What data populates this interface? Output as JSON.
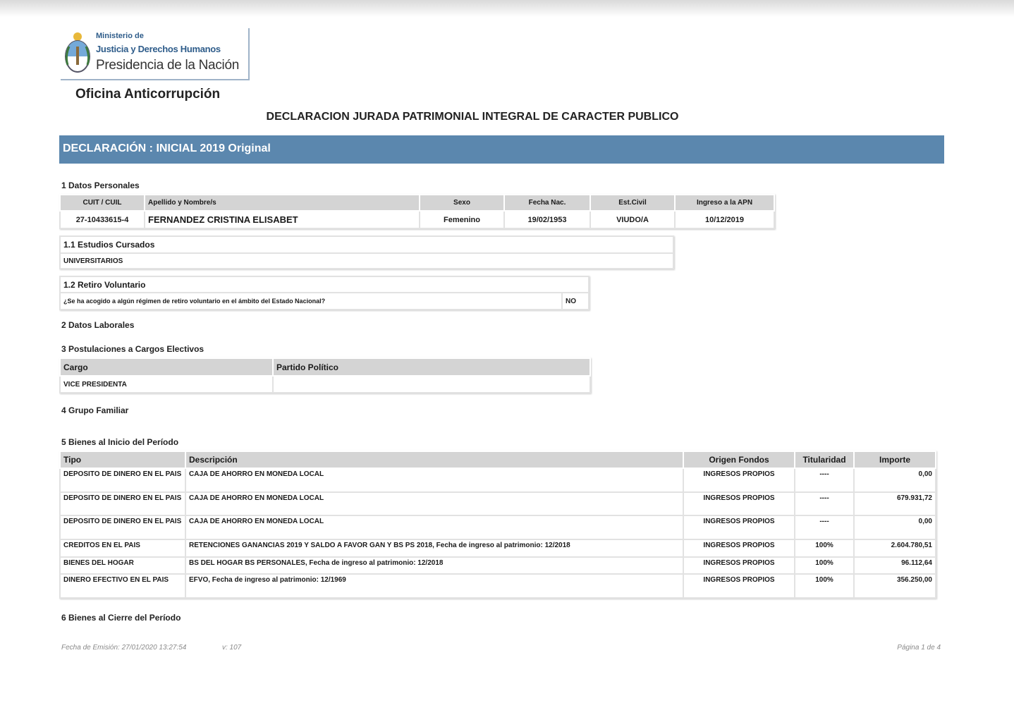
{
  "header": {
    "logo_line1": "Ministerio de",
    "logo_line2": "Justicia y Derechos Humanos",
    "logo_line3": "Presidencia de la Nación",
    "office": "Oficina Anticorrupción",
    "doc_title": "DECLARACION JURADA PATRIMONIAL INTEGRAL DE CARACTER PUBLICO"
  },
  "banner": "DECLARACIÓN :  INICIAL 2019 Original",
  "personal": {
    "section_title": "1 Datos Personales",
    "headers": [
      "CUIT / CUIL",
      "Apellido y Nombre/s",
      "Sexo",
      "Fecha Nac.",
      "Est.Civil",
      "Ingreso a la APN"
    ],
    "values": [
      "27-10433615-4",
      "FERNANDEZ CRISTINA ELISABET",
      "Femenino",
      "19/02/1953",
      "VIUDO/A",
      "10/12/2019"
    ]
  },
  "estudios": {
    "title": "1.1 Estudios Cursados",
    "value": "UNIVERSITARIOS"
  },
  "retiro": {
    "title": "1.2 Retiro Voluntario",
    "question": "¿Se ha acogido a algún régimen de retiro voluntario en el ámbito del Estado Nacional?",
    "answer": "NO"
  },
  "laborales": {
    "title": "2 Datos Laborales"
  },
  "postulaciones": {
    "title": "3 Postulaciones a Cargos Electivos",
    "headers": [
      "Cargo",
      "Partido Político"
    ],
    "row": [
      "VICE PRESIDENTA",
      ""
    ]
  },
  "grupo": {
    "title": "4 Grupo Familiar"
  },
  "bienes_inicio": {
    "title": "5 Bienes al Inicio del Período",
    "headers": [
      "Tipo",
      "Descripción",
      "Origen Fondos",
      "Titularidad",
      "Importe"
    ],
    "rows": [
      [
        "DEPOSITO DE DINERO EN EL PAIS",
        "CAJA DE AHORRO EN MONEDA LOCAL",
        "INGRESOS PROPIOS",
        "----",
        "0,00"
      ],
      [
        "DEPOSITO DE DINERO EN EL PAIS",
        "CAJA DE AHORRO EN MONEDA LOCAL",
        "INGRESOS PROPIOS",
        "----",
        "679.931,72"
      ],
      [
        "DEPOSITO DE DINERO EN EL PAIS",
        "CAJA DE AHORRO EN MONEDA LOCAL",
        "INGRESOS PROPIOS",
        "----",
        "0,00"
      ],
      [
        "CREDITOS EN EL PAIS",
        "RETENCIONES GANANCIAS 2019 Y SALDO A FAVOR GAN Y BS PS 2018, Fecha de ingreso al patrimonio: 12/2018",
        "INGRESOS PROPIOS",
        "100%",
        "2.604.780,51"
      ],
      [
        "BIENES DEL HOGAR",
        "BS DEL HOGAR BS PERSONALES, Fecha de ingreso al patrimonio: 12/2018",
        "INGRESOS PROPIOS",
        "100%",
        "96.112,64"
      ],
      [
        "DINERO EFECTIVO EN EL PAIS",
        "EFVO, Fecha de ingreso al patrimonio: 12/1969",
        "INGRESOS PROPIOS",
        "100%",
        "356.250,00"
      ]
    ]
  },
  "bienes_cierre": {
    "title": "6 Bienes al Cierre del Período"
  },
  "footer": {
    "emision": "Fecha de Emisión: 27/01/2020 13:27:54",
    "version": "v: 107",
    "page": "Página 1 de 4"
  },
  "colors": {
    "banner": "#5b87ae",
    "header_cell": "#d4d4d4"
  }
}
